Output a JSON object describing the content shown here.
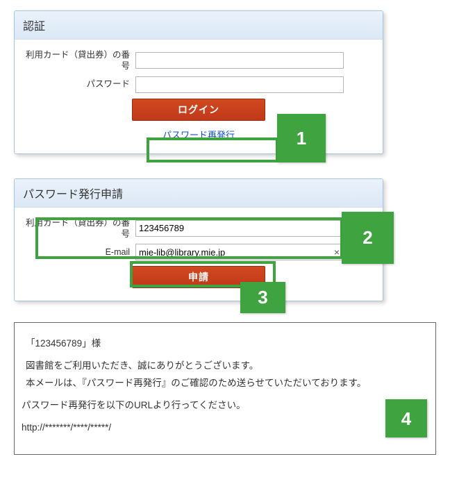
{
  "auth_panel": {
    "title": "認証",
    "card_label": "利用カード（貸出券）の番号",
    "password_label": "パスワード",
    "login_btn": "ログイン",
    "reissue_link": "パスワード再発行"
  },
  "apply_panel": {
    "title": "パスワード発行申請",
    "card_label": "利用カード（貸出券）の番号",
    "card_value": "123456789",
    "email_label": "E-mail",
    "email_value": "mie-lib@library.mie.jp",
    "apply_btn": "申請"
  },
  "mail": {
    "line1": "「123456789」様",
    "line2": "図書館をご利用いただき、誠にありがとうございます。",
    "line3": "本メールは、『パスワード再発行』のご確認のため送らせていただいております。",
    "line4": "パスワード再発行を以下のURLより行ってください。",
    "line5": "http://*******/****/*****/"
  },
  "callouts": {
    "c1": "1",
    "c2": "2",
    "c3": "3",
    "c4": "4"
  }
}
